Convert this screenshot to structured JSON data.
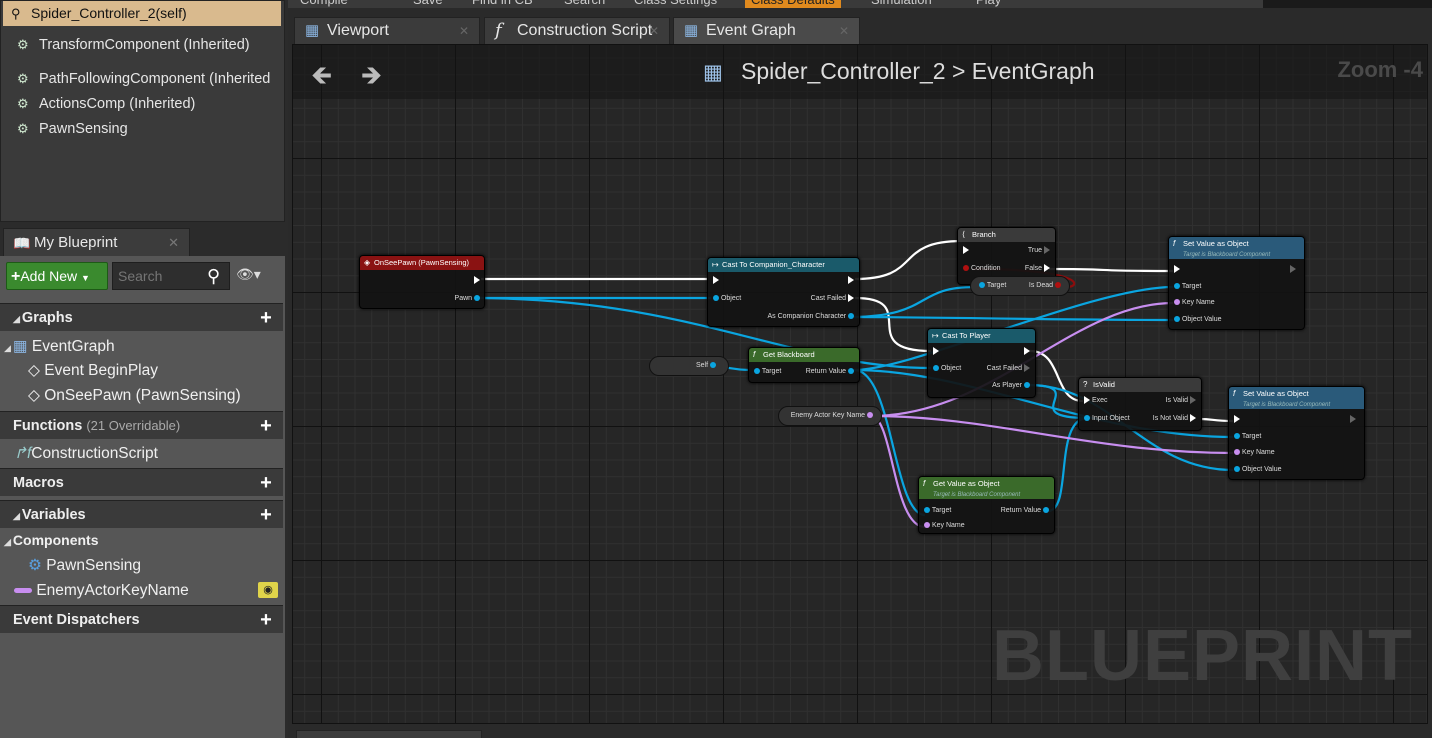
{
  "toolbar": {
    "items": [
      "Compile",
      "Save",
      "Find in CB",
      "Search",
      "Class Settings",
      "Class Defaults",
      "Simulation",
      "Play"
    ],
    "active_index": 5
  },
  "components": {
    "self": "Spider_Controller_2(self)",
    "items": [
      "TransformComponent (Inherited)",
      "PathFollowingComponent (Inherited",
      "ActionsComp (Inherited)",
      "PawnSensing"
    ]
  },
  "my_blueprint": {
    "tab_label": "My Blueprint",
    "add_new": "Add New",
    "search_placeholder": "Search",
    "sections": {
      "graphs": "Graphs",
      "functions": "Functions",
      "functions_sub": "(21 Overridable)",
      "macros": "Macros",
      "variables": "Variables",
      "components": "Components",
      "event_dispatchers": "Event Dispatchers"
    },
    "graph_items": {
      "event_graph": "EventGraph",
      "begin_play": "Event BeginPlay",
      "on_see_pawn": "OnSeePawn (PawnSensing)"
    },
    "function_items": [
      "ConstructionScript"
    ],
    "component_items": [
      "PawnSensing"
    ],
    "variable_items": [
      "EnemyActorKeyName"
    ]
  },
  "tabs": [
    "Viewport",
    "Construction Script",
    "Event Graph"
  ],
  "graph": {
    "breadcrumb_root": "Spider_Controller_2",
    "breadcrumb_sep": ">",
    "breadcrumb_leaf": "EventGraph",
    "zoom": "Zoom -4",
    "watermark": "BLUEPRINT",
    "nodes": {
      "onseepawn": {
        "title": "OnSeePawn (PawnSensing)",
        "pin": "Pawn"
      },
      "cast_companion": {
        "title": "Cast To Companion_Character",
        "object": "Object",
        "failed": "Cast Failed",
        "as": "As Companion Character"
      },
      "branch": {
        "title": "Branch",
        "cond": "Condition",
        "true": "True",
        "false": "False"
      },
      "isdead": {
        "target": "Target",
        "out": "Is Dead"
      },
      "setval1": {
        "title": "Set Value as Object",
        "sub": "Target is Blackboard Component",
        "target": "Target",
        "key": "Key Name",
        "obj": "Object Value"
      },
      "self": "Self",
      "getbb": {
        "title": "Get Blackboard",
        "target": "Target",
        "ret": "Return Value"
      },
      "cast_player": {
        "title": "Cast To Player",
        "object": "Object",
        "failed": "Cast Failed",
        "as": "As Player"
      },
      "isvalid": {
        "title": "IsValid",
        "exec": "Exec",
        "input": "Input Object",
        "valid": "Is Valid",
        "notvalid": "Is Not Valid"
      },
      "setval2": {
        "title": "Set Value as Object",
        "sub": "Target is Blackboard Component",
        "target": "Target",
        "key": "Key Name",
        "obj": "Object Value"
      },
      "enemykey": "Enemy Actor Key Name",
      "getval": {
        "title": "Get Value as Object",
        "sub": "Target is Blackboard Component",
        "target": "Target",
        "key": "Key Name",
        "ret": "Return Value"
      }
    }
  },
  "colors": {
    "exec": "#ffffff",
    "object": "#0aa5e0",
    "name": "#c88ef0",
    "bool": "#8b0d0d",
    "event_header": "#8a1212",
    "cast_header": "#1a5a6a",
    "func_header": "#2a5a7a",
    "pure_header": "#3a6a2a"
  }
}
